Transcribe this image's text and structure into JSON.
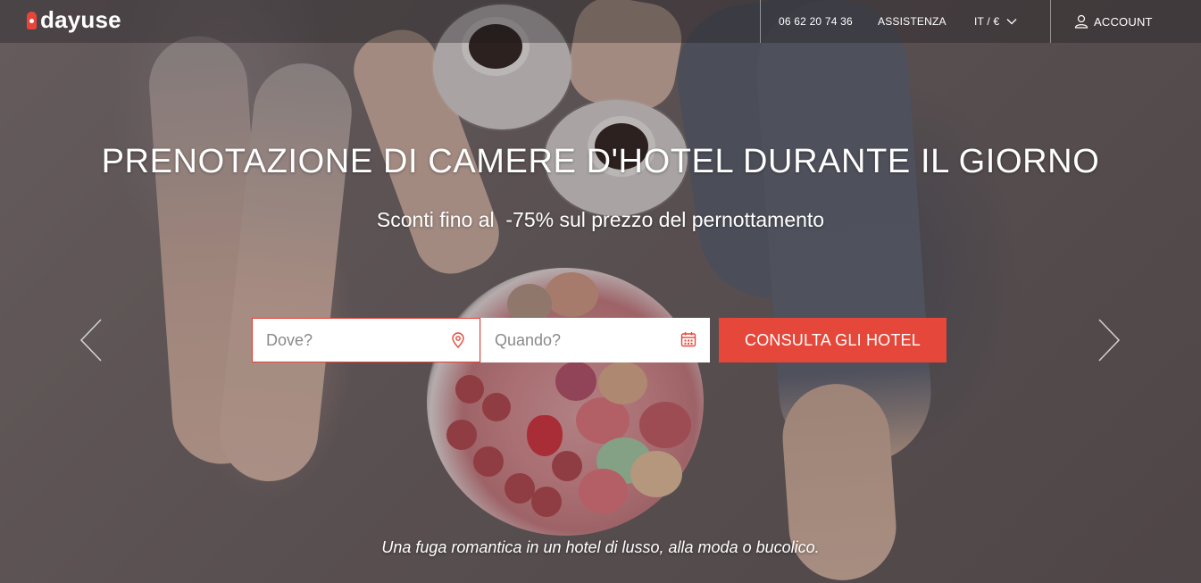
{
  "brand": {
    "name": "dayuse",
    "accent": "#e5473a"
  },
  "header": {
    "phone": "06 62 20 74 36",
    "support": "ASSISTENZA",
    "lang_currency": "IT / €",
    "account": "ACCOUNT"
  },
  "hero": {
    "title": "PRENOTAZIONE DI CAMERE D'HOTEL DURANTE IL GIORNO",
    "subtitle": "Sconti fino al  -75% sul prezzo del pernottamento",
    "tagline": "Una fuga romantica in un hotel di lusso, alla moda o bucolico."
  },
  "search": {
    "where_placeholder": "Dove?",
    "when_placeholder": "Quando?",
    "submit_label": "CONSULTA GLI HOTEL"
  },
  "icons": {
    "logo": "dayuse-logo-icon",
    "lang_dropdown": "chevron-down-icon",
    "account": "user-icon",
    "where": "map-pin-icon",
    "when": "calendar-icon",
    "prev": "chevron-left-icon",
    "next": "chevron-right-icon"
  }
}
